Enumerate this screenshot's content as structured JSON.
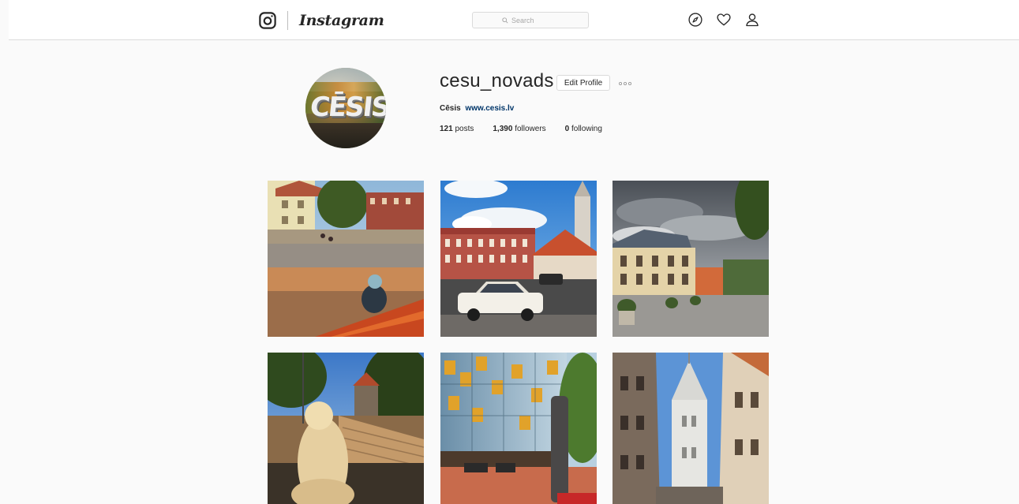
{
  "header": {
    "brand": "Instagram",
    "search_placeholder": "Search"
  },
  "profile": {
    "username": "cesu_novads",
    "edit_label": "Edit Profile",
    "avatar_text": "CĒSIS",
    "bio_name": "Cēsis",
    "bio_link": "www.cesis.lv",
    "stats": [
      {
        "num": "121",
        "label": "posts"
      },
      {
        "num": "1,390",
        "label": "followers"
      },
      {
        "num": "0",
        "label": "following"
      }
    ]
  },
  "icons": {
    "camera": "camera-icon",
    "search": "search-icon",
    "explore": "compass-icon",
    "activity": "heart-icon",
    "profile": "person-icon",
    "more": "more-dots-icon"
  },
  "posts": [
    {
      "alt": "town square fountain"
    },
    {
      "alt": "red building and vintage car"
    },
    {
      "alt": "old houses under cloudy sky"
    },
    {
      "alt": "child statue in park"
    },
    {
      "alt": "modern glass building"
    },
    {
      "alt": "church tower between buildings"
    }
  ],
  "colors": {
    "background": "#fafafa",
    "border": "#dbdbdb",
    "link": "#003569"
  }
}
